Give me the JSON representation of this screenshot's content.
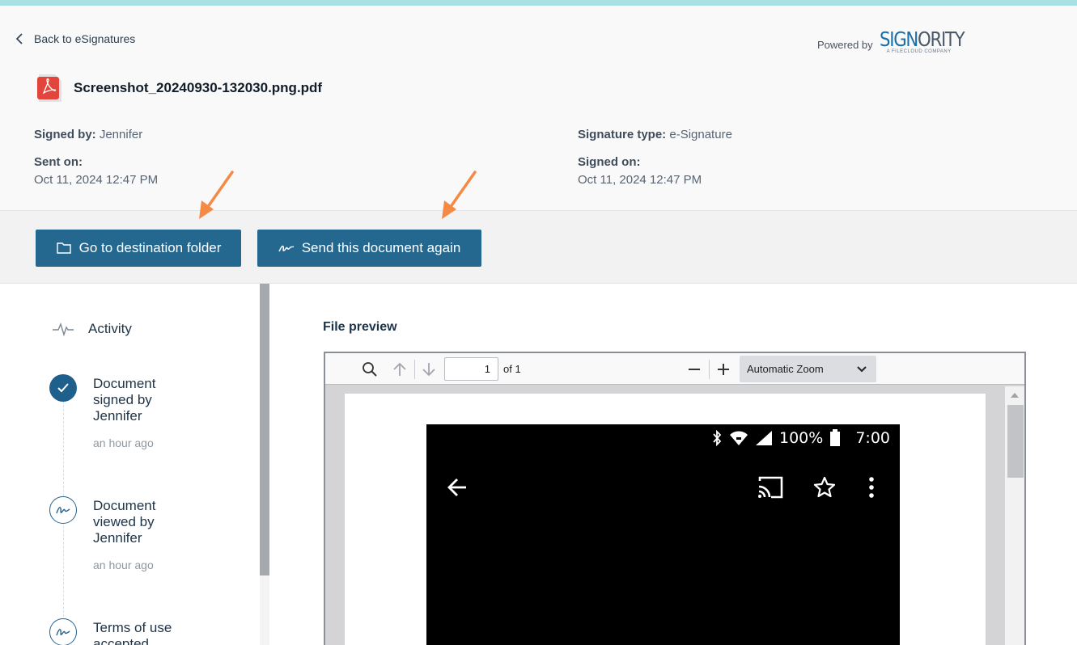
{
  "header": {
    "back_label": "Back to eSignatures",
    "powered_by": "Powered by",
    "logo_part_a": "SIGN",
    "logo_part_b": "ORITY",
    "logo_sub": "A FILECLOUD COMPANY",
    "file_name": "Screenshot_20240930-132030.png.pdf"
  },
  "meta": {
    "signed_by_label": "Signed by:",
    "signed_by_value": "Jennifer",
    "sent_on_label": "Sent on:",
    "sent_on_value": "Oct 11, 2024 12:47 PM",
    "signature_type_label": "Signature type:",
    "signature_type_value": "e-Signature",
    "signed_on_label": "Signed on:",
    "signed_on_value": "Oct 11, 2024 12:47 PM"
  },
  "actions": {
    "destination_label": "Go to destination folder",
    "send_again_label": "Send this document again"
  },
  "activity": {
    "title": "Activity",
    "items": [
      {
        "text": "Document signed by Jennifer",
        "time": "an hour ago"
      },
      {
        "text": "Document viewed by Jennifer",
        "time": "an hour ago"
      },
      {
        "text": "Terms of use accepted",
        "time": ""
      }
    ]
  },
  "preview": {
    "title": "File preview",
    "page_value": "1",
    "page_of": "of 1",
    "zoom_value": "Automatic Zoom"
  },
  "phone": {
    "battery": "100%",
    "time": "7:00"
  },
  "colors": {
    "accent": "#246890",
    "arrow": "#f58a45",
    "top_strip": "#a9e0e3"
  }
}
